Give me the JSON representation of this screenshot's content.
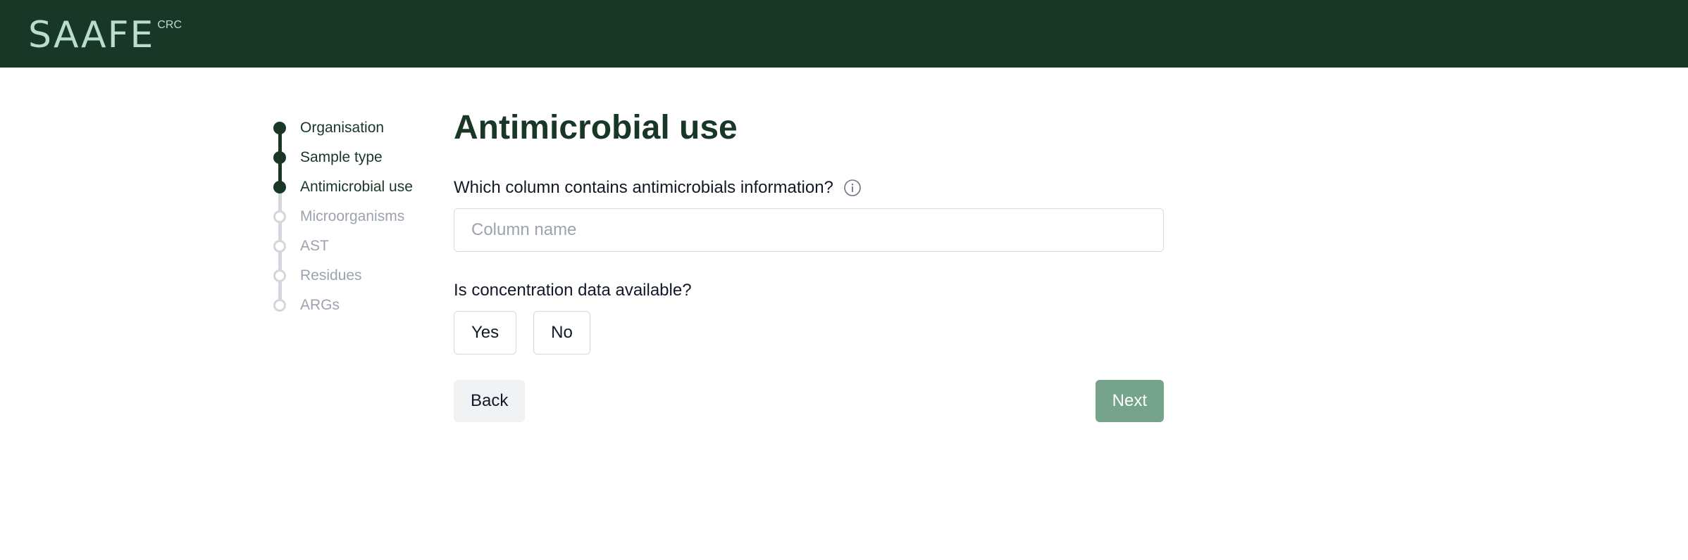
{
  "header": {
    "logo_text": "SAAFE",
    "logo_superscript": "CRC"
  },
  "stepper": {
    "steps": [
      {
        "label": "Organisation",
        "state": "done"
      },
      {
        "label": "Sample type",
        "state": "done"
      },
      {
        "label": "Antimicrobial use",
        "state": "done"
      },
      {
        "label": "Microorganisms",
        "state": "todo"
      },
      {
        "label": "AST",
        "state": "todo"
      },
      {
        "label": "Residues",
        "state": "todo"
      },
      {
        "label": "ARGs",
        "state": "todo"
      }
    ]
  },
  "main": {
    "title": "Antimicrobial use",
    "column_question": "Which column contains antimicrobials information?",
    "column_input": {
      "value": "",
      "placeholder": "Column name"
    },
    "concentration_question": "Is concentration data available?",
    "yes_label": "Yes",
    "no_label": "No",
    "back_label": "Back",
    "next_label": "Next"
  },
  "colors": {
    "header_bg": "#183726",
    "logo": "#b8dccd",
    "primary": "#183726",
    "next_button": "#76a38b",
    "inactive": "#9ca3af"
  },
  "icons": {
    "info": "info-icon"
  }
}
